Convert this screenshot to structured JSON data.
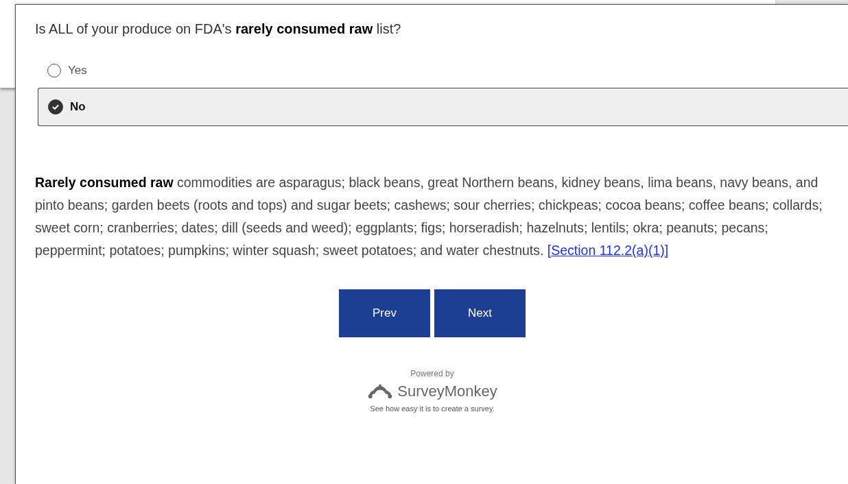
{
  "question": "Is ALL of your produce on FDA's **rarely consumed raw** list?",
  "options": [
    {
      "label": "Yes",
      "selected": false
    },
    {
      "label": "No",
      "selected": true
    }
  ],
  "note": {
    "text": "**Rarely consumed raw** commodities are asparagus; black beans, great Northern beans, kidney beans, lima beans, navy beans, and pinto beans; garden beets (roots and tops) and sugar beets; cashews; sour cherries; chickpeas; cocoa beans; coffee beans; collards; sweet corn; cranberries; dates; dill (seeds and weed); eggplants; figs; horseradish; hazelnuts; lentils; okra; peanuts; pecans; peppermint; potatoes; pumpkins; winter squash; sweet potatoes; and water chestnuts.",
    "link": "[Section 112.2(a)(1)]"
  },
  "buttons": [
    "Prev",
    "Next"
  ],
  "footer": {
    "powered_by": "Powered by",
    "brand": "SurveyMonkey",
    "tagline": "See how easy it is to create a survey."
  }
}
